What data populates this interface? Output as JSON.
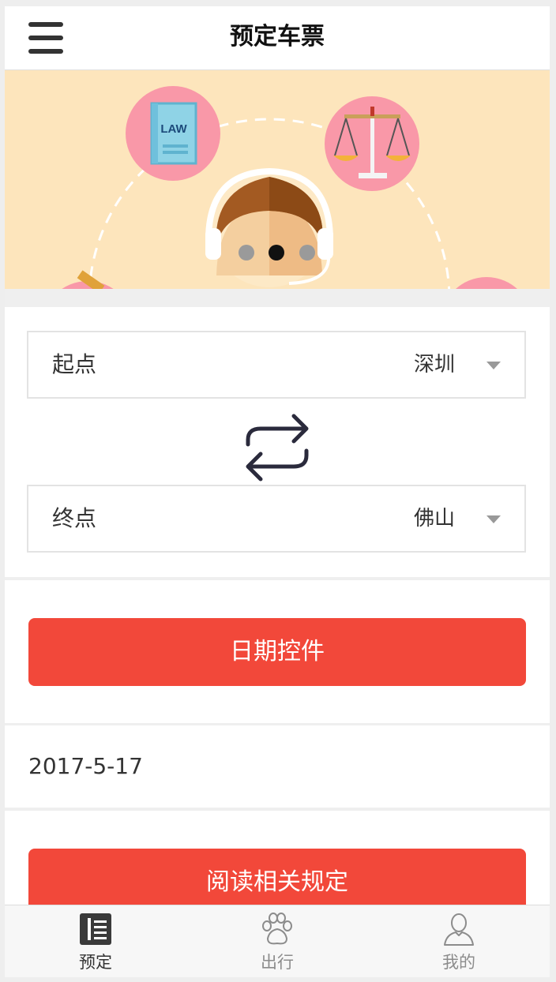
{
  "header": {
    "title": "预定车票"
  },
  "banner": {
    "book_label": "LAW"
  },
  "route": {
    "origin": {
      "label": "起点",
      "value": "深圳"
    },
    "destination": {
      "label": "终点",
      "value": "佛山"
    }
  },
  "date_picker": {
    "button_label": "日期控件",
    "selected_date": "2017-5-17"
  },
  "rules": {
    "button_label": "阅读相关规定"
  },
  "tabbar": {
    "items": [
      {
        "label": "预定",
        "icon": "list-icon",
        "active": true
      },
      {
        "label": "出行",
        "icon": "paw-icon",
        "active": false
      },
      {
        "label": "我的",
        "icon": "user-icon",
        "active": false
      }
    ]
  },
  "colors": {
    "accent": "#f2483a",
    "banner_bg": "#fde5bc"
  }
}
